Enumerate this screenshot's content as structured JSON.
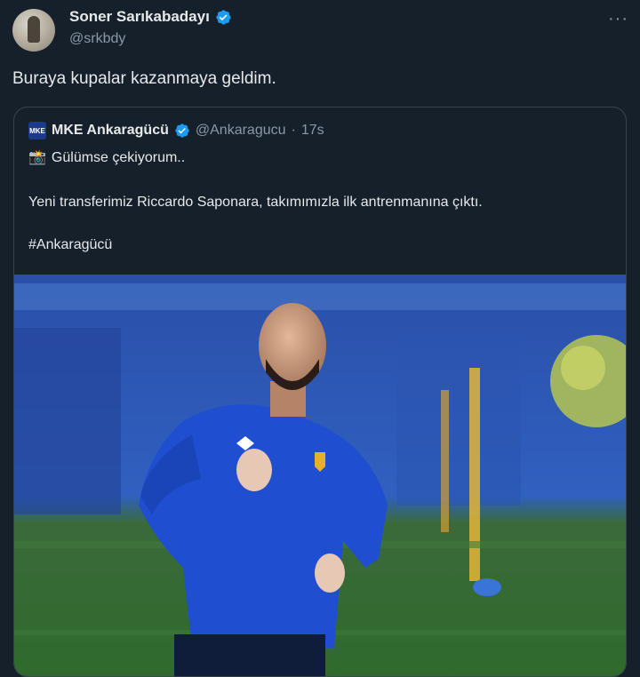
{
  "tweet": {
    "author_name": "Soner Sarıkabadayı",
    "author_handle": "@srkbdy",
    "more_icon": "more-icon",
    "text": "Buraya kupalar kazanmaya geldim."
  },
  "quote": {
    "author_name": "MKE Ankaragücü",
    "author_handle": "@Ankaragucu",
    "separator": "·",
    "time": "17s",
    "line1": "Gülümse çekiyorum..",
    "line2": "Yeni transferimiz Riccardo Saponara, takımımızla ilk antrenmanına çıktı.",
    "hashtag": "#Ankaragücü",
    "logo_text": "MKE"
  },
  "colors": {
    "background": "#15202b",
    "verified": "#1d9bf0",
    "hashtag": "#e7e9ea",
    "secondary": "#8b98a5"
  }
}
